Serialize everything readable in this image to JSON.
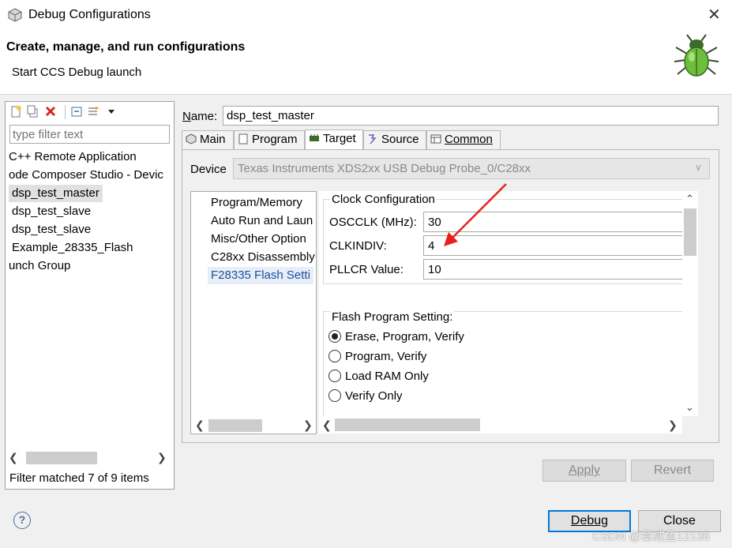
{
  "window": {
    "title": "Debug Configurations",
    "close_glyph": "✕"
  },
  "header": {
    "title": "Create, manage, and run configurations",
    "subtitle": "Start CCS Debug launch",
    "icon": "bug-icon"
  },
  "left_panel": {
    "toolbar_icons": [
      "new-config-icon",
      "duplicate-icon",
      "delete-icon",
      "collapse-all-icon",
      "filter-icon",
      "dropdown-arrow-icon"
    ],
    "filter_placeholder": "type filter text",
    "tree_items": [
      {
        "label": "C++ Remote Application",
        "selected": false
      },
      {
        "label": "ode Composer Studio - Devic",
        "selected": false
      },
      {
        "label": "dsp_test_master",
        "selected": true
      },
      {
        "label": "dsp_test_slave",
        "selected": false
      },
      {
        "label": "dsp_test_slave",
        "selected": false
      },
      {
        "label": "Example_28335_Flash",
        "selected": false
      },
      {
        "label": "unch Group",
        "selected": false
      }
    ],
    "filter_status": "Filter matched 7 of 9 items"
  },
  "config": {
    "name_label": "Name:",
    "name_value": "dsp_test_master",
    "tabs": [
      {
        "label": "Main",
        "icon": "main-tab-icon",
        "active": false
      },
      {
        "label": "Program",
        "icon": "program-tab-icon",
        "active": false
      },
      {
        "label": "Target",
        "icon": "target-tab-icon",
        "active": true
      },
      {
        "label": "Source",
        "icon": "source-tab-icon",
        "active": false
      },
      {
        "label": "Common",
        "icon": "common-tab-icon",
        "active": false
      }
    ],
    "device_label": "Device",
    "device_value": "Texas Instruments XDS2xx USB Debug Probe_0/C28xx",
    "categories": [
      {
        "label": "Program/Memory",
        "selected": false
      },
      {
        "label": "Auto Run and Laun",
        "selected": false
      },
      {
        "label": "Misc/Other Option",
        "selected": false
      },
      {
        "label": "C28xx Disassembly",
        "selected": false
      },
      {
        "label": "F28335 Flash Setti",
        "selected": true
      }
    ],
    "clock": {
      "title": "Clock Configuration",
      "fields": [
        {
          "label": "OSCCLK (MHz):",
          "value": "30"
        },
        {
          "label": "CLKINDIV:",
          "value": "4"
        },
        {
          "label": "PLLCR Value:",
          "value": "10"
        }
      ]
    },
    "flash": {
      "title": "Flash Program Setting:",
      "options": [
        {
          "label": "Erase, Program, Verify",
          "checked": true
        },
        {
          "label": "Program, Verify",
          "checked": false
        },
        {
          "label": "Load RAM Only",
          "checked": false
        },
        {
          "label": "Verify Only",
          "checked": false
        }
      ]
    },
    "apply_label": "Apply",
    "revert_label": "Revert"
  },
  "footer": {
    "debug_label": "Debug",
    "close_label": "Close",
    "help_glyph": "?"
  },
  "watermark": "CSDN @章咸鱼12138",
  "colors": {
    "arrow": "#e8201c",
    "focus": "#0078d7",
    "selection": "#e0e0e0"
  }
}
